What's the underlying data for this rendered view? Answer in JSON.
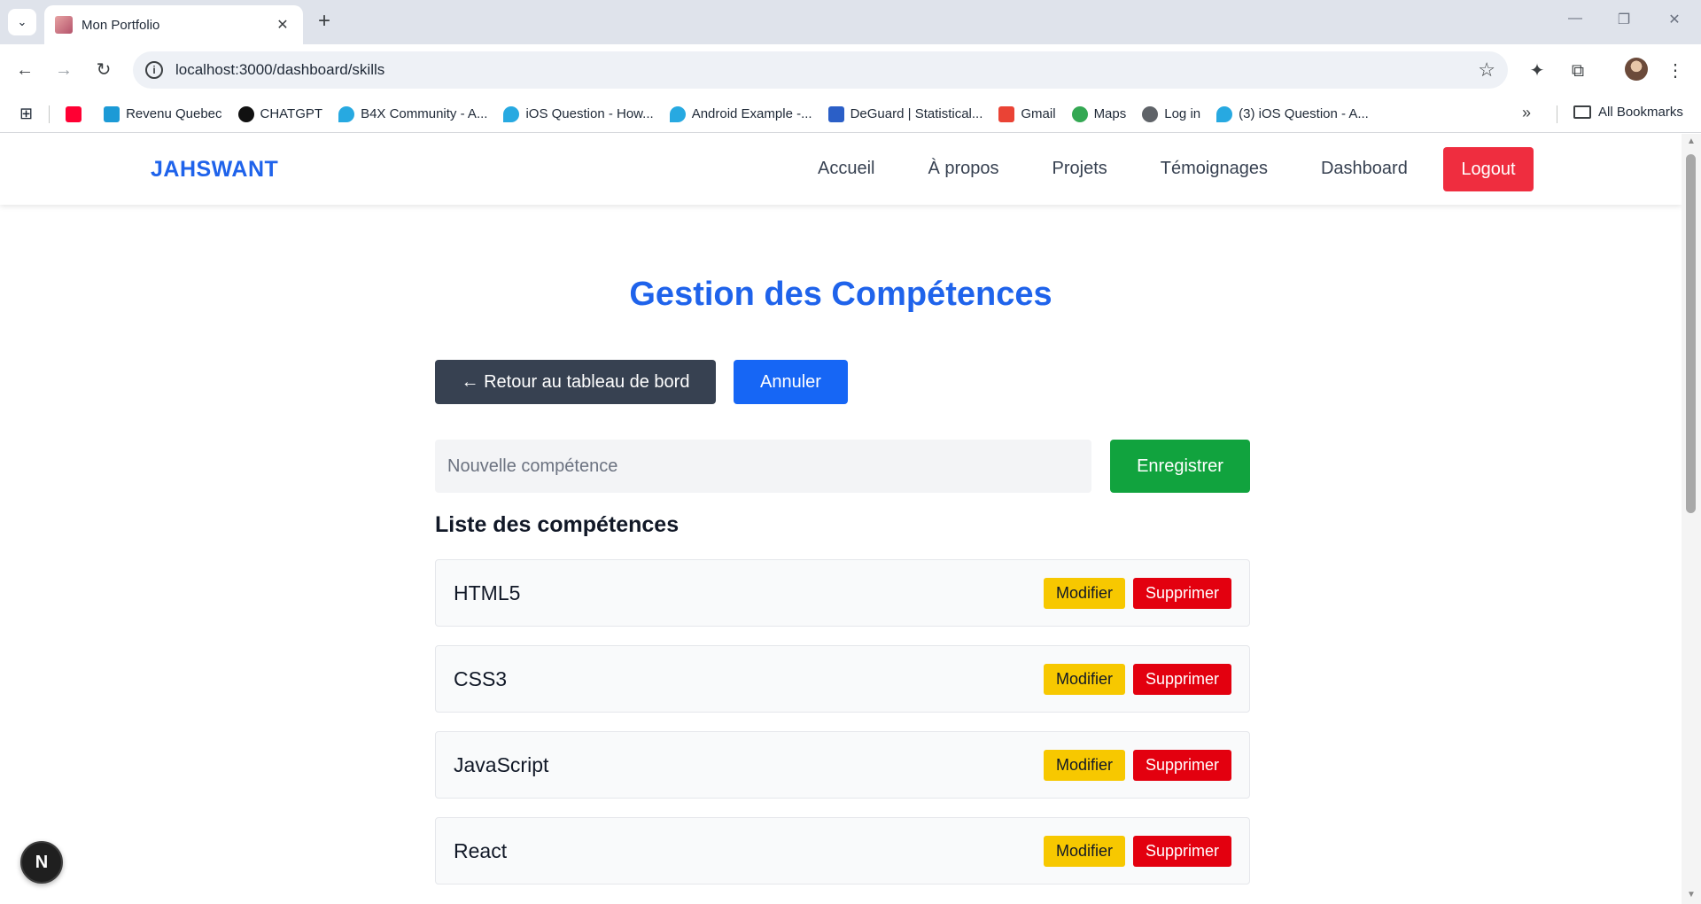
{
  "browser": {
    "tab_title": "Mon Portfolio",
    "url": "localhost:3000/dashboard/skills",
    "bookmarks": [
      {
        "label": "",
        "icon": "youtube-icon",
        "color": "#ff0033"
      },
      {
        "label": "Revenu Quebec",
        "icon": "revenu-quebec-icon",
        "color": "#1c9ad6"
      },
      {
        "label": "CHATGPT",
        "icon": "chatgpt-icon",
        "color": "#111111"
      },
      {
        "label": "B4X Community - A...",
        "icon": "b4x-icon",
        "color": "#27a9e1"
      },
      {
        "label": "iOS Question - How...",
        "icon": "b4x-icon",
        "color": "#27a9e1"
      },
      {
        "label": "Android Example -...",
        "icon": "b4x-icon",
        "color": "#27a9e1"
      },
      {
        "label": "DeGuard | Statistical...",
        "icon": "deguard-icon",
        "color": "#2b5fc7"
      },
      {
        "label": "Gmail",
        "icon": "gmail-icon",
        "color": "#ea4335"
      },
      {
        "label": "Maps",
        "icon": "maps-icon",
        "color": "#34a853"
      },
      {
        "label": "Log in",
        "icon": "globe-icon",
        "color": "#5f6368"
      },
      {
        "label": "(3) iOS Question - A...",
        "icon": "b4x-icon",
        "color": "#27a9e1"
      }
    ],
    "all_bookmarks_label": "All Bookmarks"
  },
  "site": {
    "brand": "JAHSWANT",
    "nav": [
      "Accueil",
      "À propos",
      "Projets",
      "Témoignages",
      "Dashboard"
    ],
    "logout_label": "Logout",
    "accent_color": "#1f63eb"
  },
  "page": {
    "title": "Gestion des Compétences",
    "back_label": "← Retour au tableau de bord",
    "cancel_label": "Annuler",
    "input_placeholder": "Nouvelle compétence",
    "input_value": "",
    "save_label": "Enregistrer",
    "list_title": "Liste des compétences",
    "edit_label": "Modifier",
    "delete_label": "Supprimer",
    "skills": [
      "HTML5",
      "CSS3",
      "JavaScript",
      "React"
    ]
  },
  "dev_badge": "N"
}
